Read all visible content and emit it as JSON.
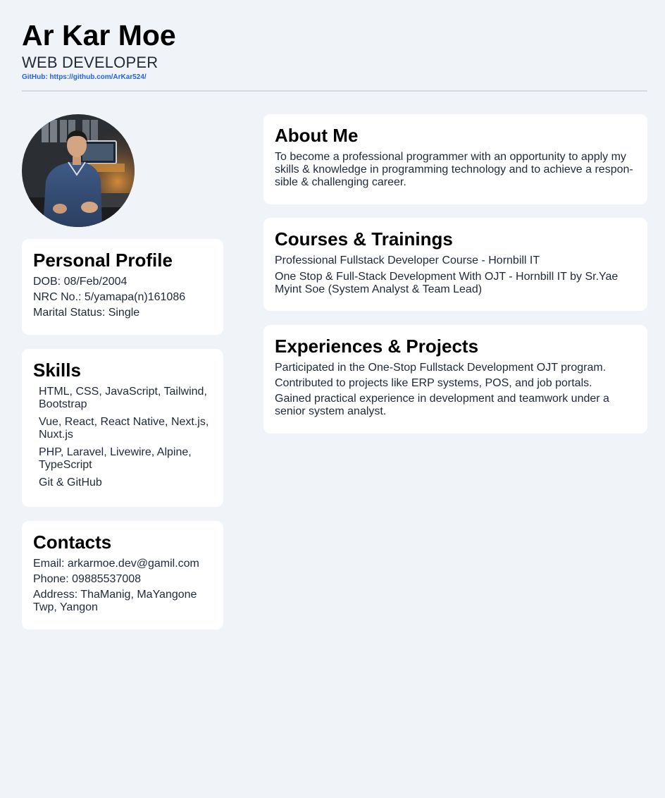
{
  "header": {
    "name": "Ar Kar Moe",
    "role": "WEB DEVELOPER",
    "github": "GitHub: https://github.com/ArKar524/"
  },
  "profile": {
    "title": "Personal Profile",
    "items": [
      "DOB: 08/Feb/2004",
      "NRC No.: 5/yamapa(n)161086",
      "Marital Status: Single"
    ]
  },
  "skills": {
    "title": "Skills",
    "items": [
      "HTML, CSS, JavaScript, Tailwind, Bootstrap",
      "Vue, React, React Native, Next.js, Nuxt.js",
      "PHP, Laravel, Livewire, Alpine, TypeScript",
      "Git & GitHub"
    ]
  },
  "contacts": {
    "title": "Contacts",
    "items": [
      "Email: arkarmoe.dev@gamil.com",
      "Phone: 09885537008",
      "Address: ThaManig, MaYangone Twp, Yangon"
    ]
  },
  "about": {
    "title": "About Me",
    "text": "To become a professional programmer with an opportunity to apply my skills & knowledge in programming technology and to achieve a respon-sible & challenging career."
  },
  "courses": {
    "title": "Courses & Trainings",
    "items": [
      "Professional Fullstack Developer Course - Hornbill IT",
      "One Stop & Full-Stack Development With OJT - Hornbill IT by Sr.Yae Myint Soe (System Analyst & Team Lead)"
    ]
  },
  "experience": {
    "title": "Experiences & Projects",
    "items": [
      "Participated in the One-Stop Fullstack Development OJT program.",
      "Contributed to projects like ERP systems, POS, and job portals.",
      "Gained practical experience in development and teamwork under a senior system analyst."
    ]
  },
  "colors": {
    "background": "#f0f3f8",
    "card": "#ffffff",
    "link": "#2563eb"
  }
}
